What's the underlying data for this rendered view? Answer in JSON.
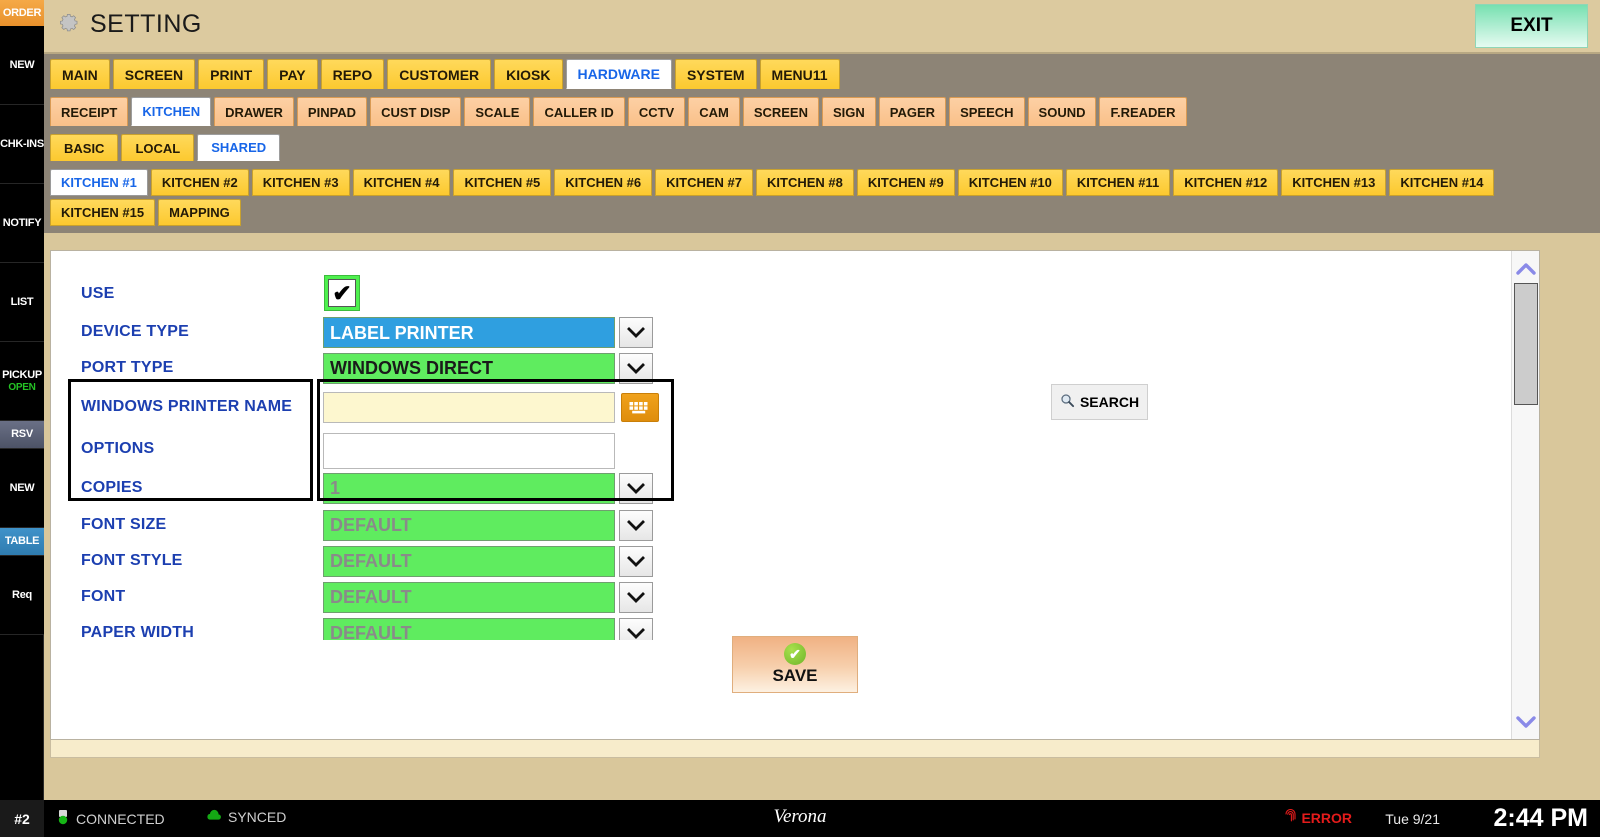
{
  "sidebar": {
    "items": [
      {
        "label": "ORDER",
        "style": "order"
      },
      {
        "label": "NEW",
        "style": "plain"
      },
      {
        "label": "CHK-INS",
        "style": "plain"
      },
      {
        "label": "NOTIFY",
        "style": "plain"
      },
      {
        "label": "LIST",
        "style": "plain"
      },
      {
        "label": "PICKUP",
        "sub": "OPEN",
        "style": "plain"
      },
      {
        "label": "RSV",
        "style": "rsv"
      },
      {
        "label": "NEW",
        "style": "plain"
      },
      {
        "label": "TABLE",
        "style": "table"
      },
      {
        "label": "Req",
        "style": "plain"
      }
    ]
  },
  "header": {
    "title": "SETTING",
    "gear_icon": "gear-icon",
    "exit_label": "EXIT"
  },
  "tabs_level1": [
    {
      "label": "MAIN",
      "active": false
    },
    {
      "label": "SCREEN",
      "active": false
    },
    {
      "label": "PRINT",
      "active": false
    },
    {
      "label": "PAY",
      "active": false
    },
    {
      "label": "REPO",
      "active": false
    },
    {
      "label": "CUSTOMER",
      "active": false
    },
    {
      "label": "KIOSK",
      "active": false
    },
    {
      "label": "HARDWARE",
      "active": true
    },
    {
      "label": "SYSTEM",
      "active": false
    },
    {
      "label": "MENU11",
      "active": false
    }
  ],
  "tabs_level2": [
    {
      "label": "RECEIPT",
      "active": false
    },
    {
      "label": "KITCHEN",
      "active": true
    },
    {
      "label": "DRAWER",
      "active": false
    },
    {
      "label": "PINPAD",
      "active": false
    },
    {
      "label": "CUST DISP",
      "active": false
    },
    {
      "label": "SCALE",
      "active": false
    },
    {
      "label": "CALLER ID",
      "active": false
    },
    {
      "label": "CCTV",
      "active": false
    },
    {
      "label": "CAM",
      "active": false
    },
    {
      "label": "SCREEN",
      "active": false
    },
    {
      "label": "SIGN",
      "active": false
    },
    {
      "label": "PAGER",
      "active": false
    },
    {
      "label": "SPEECH",
      "active": false
    },
    {
      "label": "SOUND",
      "active": false
    },
    {
      "label": "F.READER",
      "active": false
    }
  ],
  "tabs_level3": [
    {
      "label": "BASIC",
      "active": false
    },
    {
      "label": "LOCAL",
      "active": false
    },
    {
      "label": "SHARED",
      "active": true
    }
  ],
  "kitchen_tabs": [
    {
      "label": "KITCHEN #1",
      "active": true
    },
    {
      "label": "KITCHEN #2",
      "active": false
    },
    {
      "label": "KITCHEN #3",
      "active": false
    },
    {
      "label": "KITCHEN #4",
      "active": false
    },
    {
      "label": "KITCHEN #5",
      "active": false
    },
    {
      "label": "KITCHEN #6",
      "active": false
    },
    {
      "label": "KITCHEN #7",
      "active": false
    },
    {
      "label": "KITCHEN #8",
      "active": false
    },
    {
      "label": "KITCHEN #9",
      "active": false
    },
    {
      "label": "KITCHEN #10",
      "active": false
    },
    {
      "label": "KITCHEN #11",
      "active": false
    },
    {
      "label": "KITCHEN #12",
      "active": false
    },
    {
      "label": "KITCHEN #13",
      "active": false
    },
    {
      "label": "KITCHEN #14",
      "active": false
    },
    {
      "label": "KITCHEN #15",
      "active": false
    },
    {
      "label": "MAPPING",
      "active": false
    }
  ],
  "form": {
    "use": {
      "label": "USE",
      "checked": true,
      "check_glyph": "✔"
    },
    "device_type": {
      "label": "DEVICE TYPE",
      "value": "LABEL PRINTER"
    },
    "port_type": {
      "label": "PORT TYPE",
      "value": "WINDOWS DIRECT"
    },
    "printer_name": {
      "label": "WINDOWS PRINTER NAME",
      "value": "",
      "keyboard_icon": "keyboard-icon"
    },
    "options": {
      "label": "OPTIONS",
      "value": ""
    },
    "copies": {
      "label": "COPIES",
      "value": "1"
    },
    "font_size": {
      "label": "FONT SIZE",
      "value": "DEFAULT"
    },
    "font_style": {
      "label": "FONT STYLE",
      "value": "DEFAULT"
    },
    "font": {
      "label": "FONT",
      "value": "DEFAULT"
    },
    "paper_width": {
      "label": "PAPER WIDTH",
      "value": "DEFAULT"
    }
  },
  "search": {
    "label": "SEARCH",
    "icon": "search-icon"
  },
  "save": {
    "label": "SAVE",
    "icon": "check-circle-icon",
    "glyph": "✔"
  },
  "status": {
    "terminal": "#2",
    "connected": "CONNECTED",
    "synced": "SYNCED",
    "brand": "Verona",
    "error": "ERROR",
    "date": "Tue 9/21",
    "time": "2:44 PM"
  },
  "colors": {
    "accent_yellow": "#fcc92f",
    "accent_peach": "#f9c089",
    "active_tab_text": "#1866e8",
    "label_blue": "#1c3fb0",
    "field_green": "#5fec5f",
    "selection_blue": "#2f9fe0",
    "error_red": "#e31b1b",
    "synced_green": "#25c225",
    "exit_green": "#77e0b0"
  }
}
